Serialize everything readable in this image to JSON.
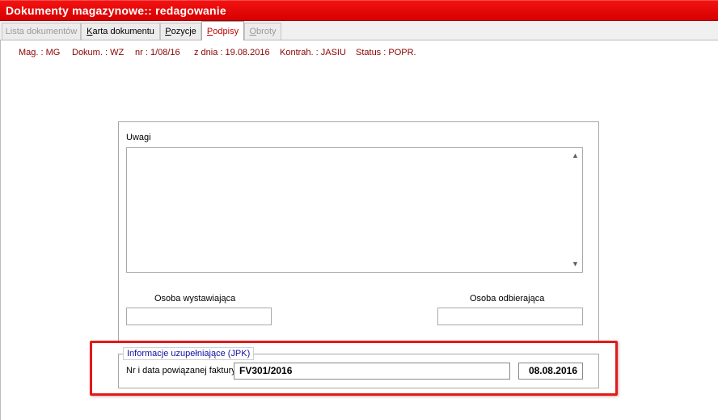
{
  "window": {
    "title": "Dokumenty magazynowe:: redagowanie"
  },
  "tabs": [
    {
      "label": "Lista dokumentów",
      "state": "disabled"
    },
    {
      "label_pre": "K",
      "label_rest": "arta dokumentu",
      "state": "normal"
    },
    {
      "label_pre": "P",
      "label_rest": "ozycje",
      "state": "normal"
    },
    {
      "label_pre": "P",
      "label_rest": "odpisy",
      "state": "active"
    },
    {
      "label_pre": "O",
      "label_rest": "broty",
      "state": "disabled"
    }
  ],
  "header_info": {
    "mag": "Mag. : MG",
    "dokum": "Dokum. : WZ",
    "nr": "nr : 1/08/16",
    "date": "z dnia : 19.08.2016",
    "kontrah": "Kontrah. : JASIU",
    "status": "Status : POPR."
  },
  "form": {
    "uwagi_label": "Uwagi",
    "uwagi_value": "",
    "osoba_wystawiajaca_label": "Osoba wystawiająca",
    "osoba_wystawiajaca_value": "",
    "osoba_odbierajaca_label": "Osoba odbierająca",
    "osoba_odbierajaca_value": ""
  },
  "jpk": {
    "legend": "Informacje uzupełniające (JPK)",
    "invoice_label": "Nr i data powiązanej faktury",
    "invoice_number": "FV301/2016",
    "invoice_date": "08.08.2016"
  },
  "colors": {
    "titlebar": "#e00000",
    "active_tab_text": "#c00000",
    "info_text": "#8b0000",
    "legend_text": "#1010a0",
    "highlight": "#e01b1b"
  }
}
